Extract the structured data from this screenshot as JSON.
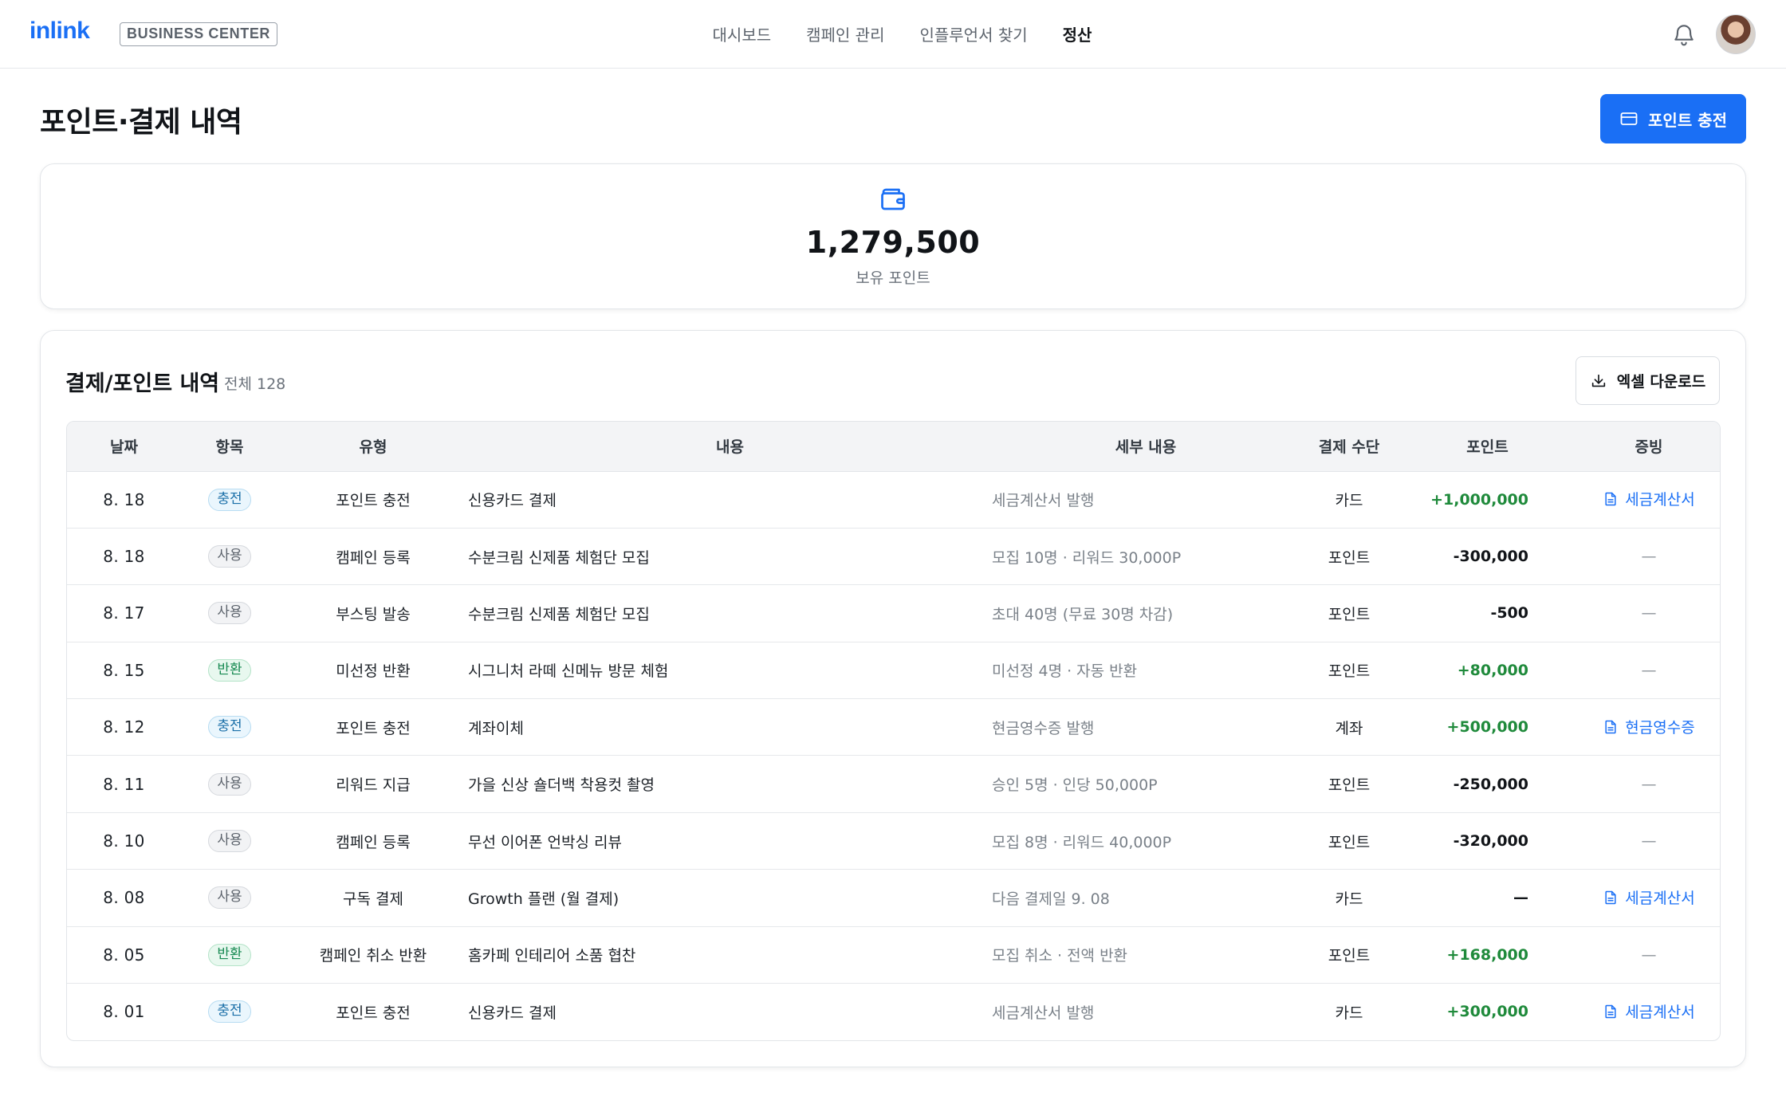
{
  "header": {
    "logo": "inlink",
    "badge": "BUSINESS CENTER",
    "nav": [
      {
        "label": "대시보드",
        "active": false
      },
      {
        "label": "캠페인 관리",
        "active": false
      },
      {
        "label": "인플루언서 찾기",
        "active": false
      },
      {
        "label": "정산",
        "active": true
      }
    ],
    "icons": {
      "notifications": "bell-icon",
      "profile": "avatar"
    }
  },
  "page": {
    "title": "포인트·결제 내역",
    "charge_button": "포인트 충전"
  },
  "balance": {
    "value": "1,279,500",
    "label": "보유 포인트"
  },
  "history": {
    "title": "결제/포인트 내역",
    "count": "전체 128",
    "excel_button": "엑셀 다운로드",
    "columns": [
      "날짜",
      "항목",
      "유형",
      "내용",
      "세부 내용",
      "결제 수단",
      "포인트",
      "증빙"
    ],
    "rows": [
      {
        "date": "8. 18",
        "category": "충전",
        "kind": "charge",
        "type": "포인트 충전",
        "content": "신용카드 결제",
        "detail": "세금계산서 발행",
        "method": "카드",
        "points": "+1,000,000",
        "sign": "pos",
        "proof": "세금계산서"
      },
      {
        "date": "8. 18",
        "category": "사용",
        "kind": "use",
        "type": "캠페인 등록",
        "content": "수분크림 신제품 체험단 모집",
        "detail": "모집 10명 · 리워드 30,000P",
        "method": "포인트",
        "points": "-300,000",
        "sign": "neg",
        "proof": "—"
      },
      {
        "date": "8. 17",
        "category": "사용",
        "kind": "use",
        "type": "부스팅 발송",
        "content": "수분크림 신제품 체험단 모집",
        "detail": "초대 40명 (무료 30명 차감)",
        "method": "포인트",
        "points": "-500",
        "sign": "neg",
        "proof": "—"
      },
      {
        "date": "8. 15",
        "category": "반환",
        "kind": "refund",
        "type": "미선정 반환",
        "content": "시그니처 라떼 신메뉴 방문 체험",
        "detail": "미선정 4명 · 자동 반환",
        "method": "포인트",
        "points": "+80,000",
        "sign": "pos",
        "proof": "—"
      },
      {
        "date": "8. 12",
        "category": "충전",
        "kind": "charge",
        "type": "포인트 충전",
        "content": "계좌이체",
        "detail": "현금영수증 발행",
        "method": "계좌",
        "points": "+500,000",
        "sign": "pos",
        "proof": "현금영수증"
      },
      {
        "date": "8. 11",
        "category": "사용",
        "kind": "use",
        "type": "리워드 지급",
        "content": "가을 신상 숄더백 착용컷 촬영",
        "detail": "승인 5명 · 인당 50,000P",
        "method": "포인트",
        "points": "-250,000",
        "sign": "neg",
        "proof": "—"
      },
      {
        "date": "8. 10",
        "category": "사용",
        "kind": "use",
        "type": "캠페인 등록",
        "content": "무선 이어폰 언박싱 리뷰",
        "detail": "모집 8명 · 리워드 40,000P",
        "method": "포인트",
        "points": "-320,000",
        "sign": "neg",
        "proof": "—"
      },
      {
        "date": "8. 08",
        "category": "사용",
        "kind": "use",
        "type": "구독 결제",
        "content": "Growth 플랜 (월 결제)",
        "detail": "다음 결제일 9. 08",
        "method": "카드",
        "points": "—",
        "sign": "neg",
        "proof": "세금계산서"
      },
      {
        "date": "8. 05",
        "category": "반환",
        "kind": "refund",
        "type": "캠페인 취소 반환",
        "content": "홈카페 인테리어 소품 협찬",
        "detail": "모집 취소 · 전액 반환",
        "method": "포인트",
        "points": "+168,000",
        "sign": "pos",
        "proof": "—"
      },
      {
        "date": "8. 01",
        "category": "충전",
        "kind": "charge",
        "type": "포인트 충전",
        "content": "신용카드 결제",
        "detail": "세금계산서 발행",
        "method": "카드",
        "points": "+300,000",
        "sign": "pos",
        "proof": "세금계산서"
      }
    ]
  },
  "colors": {
    "accent": "#1a6ff5",
    "positive": "#1f8a3b",
    "text": "#111418",
    "muted": "#7a8189"
  }
}
